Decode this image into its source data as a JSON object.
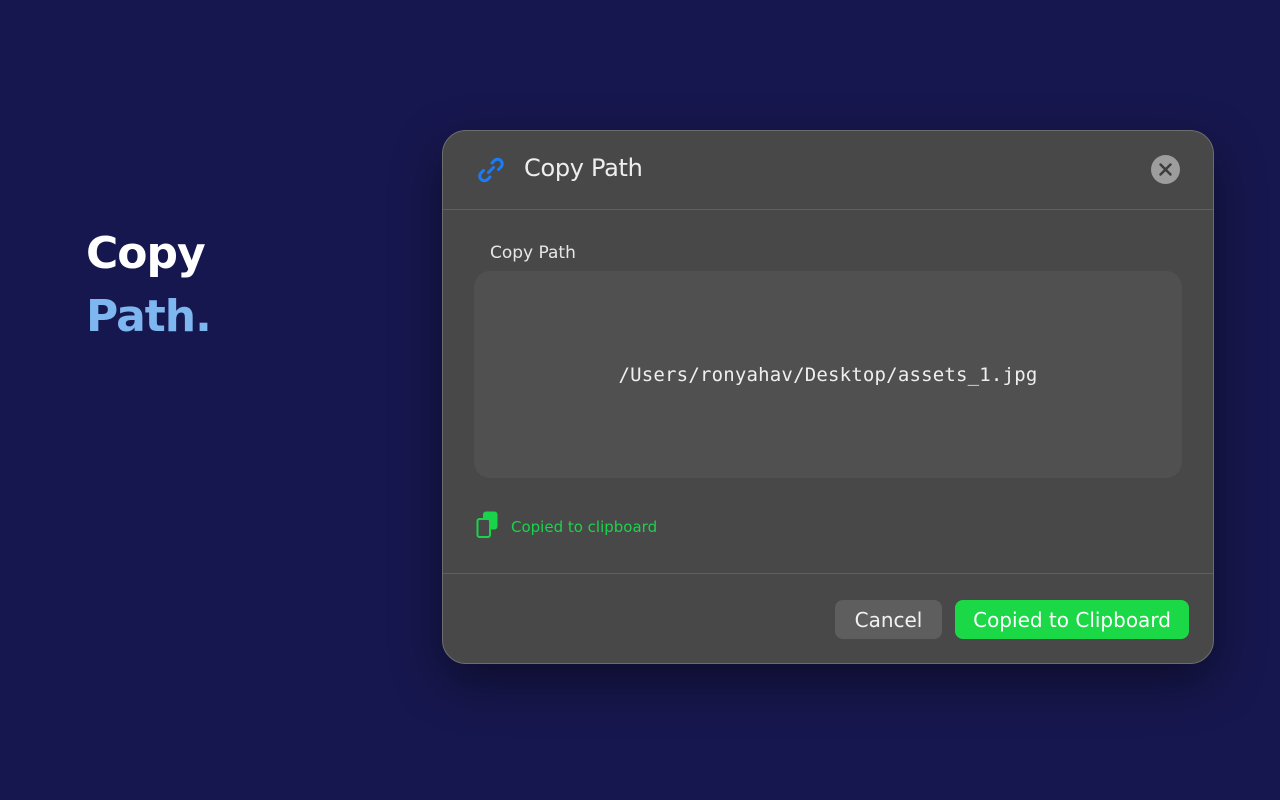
{
  "hero": {
    "line1": "Copy",
    "line2": "Path."
  },
  "dialog": {
    "title": "Copy Path",
    "icon": "link-icon",
    "close_icon": "close-icon",
    "field_label": "Copy Path",
    "path_value": "/Users/ronyahav/Desktop/assets_1.jpg",
    "status_icon": "clipboard-icon",
    "status_text": "Copied to clipboard",
    "cancel_label": "Cancel",
    "primary_label": "Copied to Clipboard"
  },
  "colors": {
    "background": "#17174f",
    "accent_blue": "#1b7cf5",
    "hero_accent": "#7eb6ef",
    "success_green": "#1ad846",
    "dialog_bg": "#484848"
  }
}
